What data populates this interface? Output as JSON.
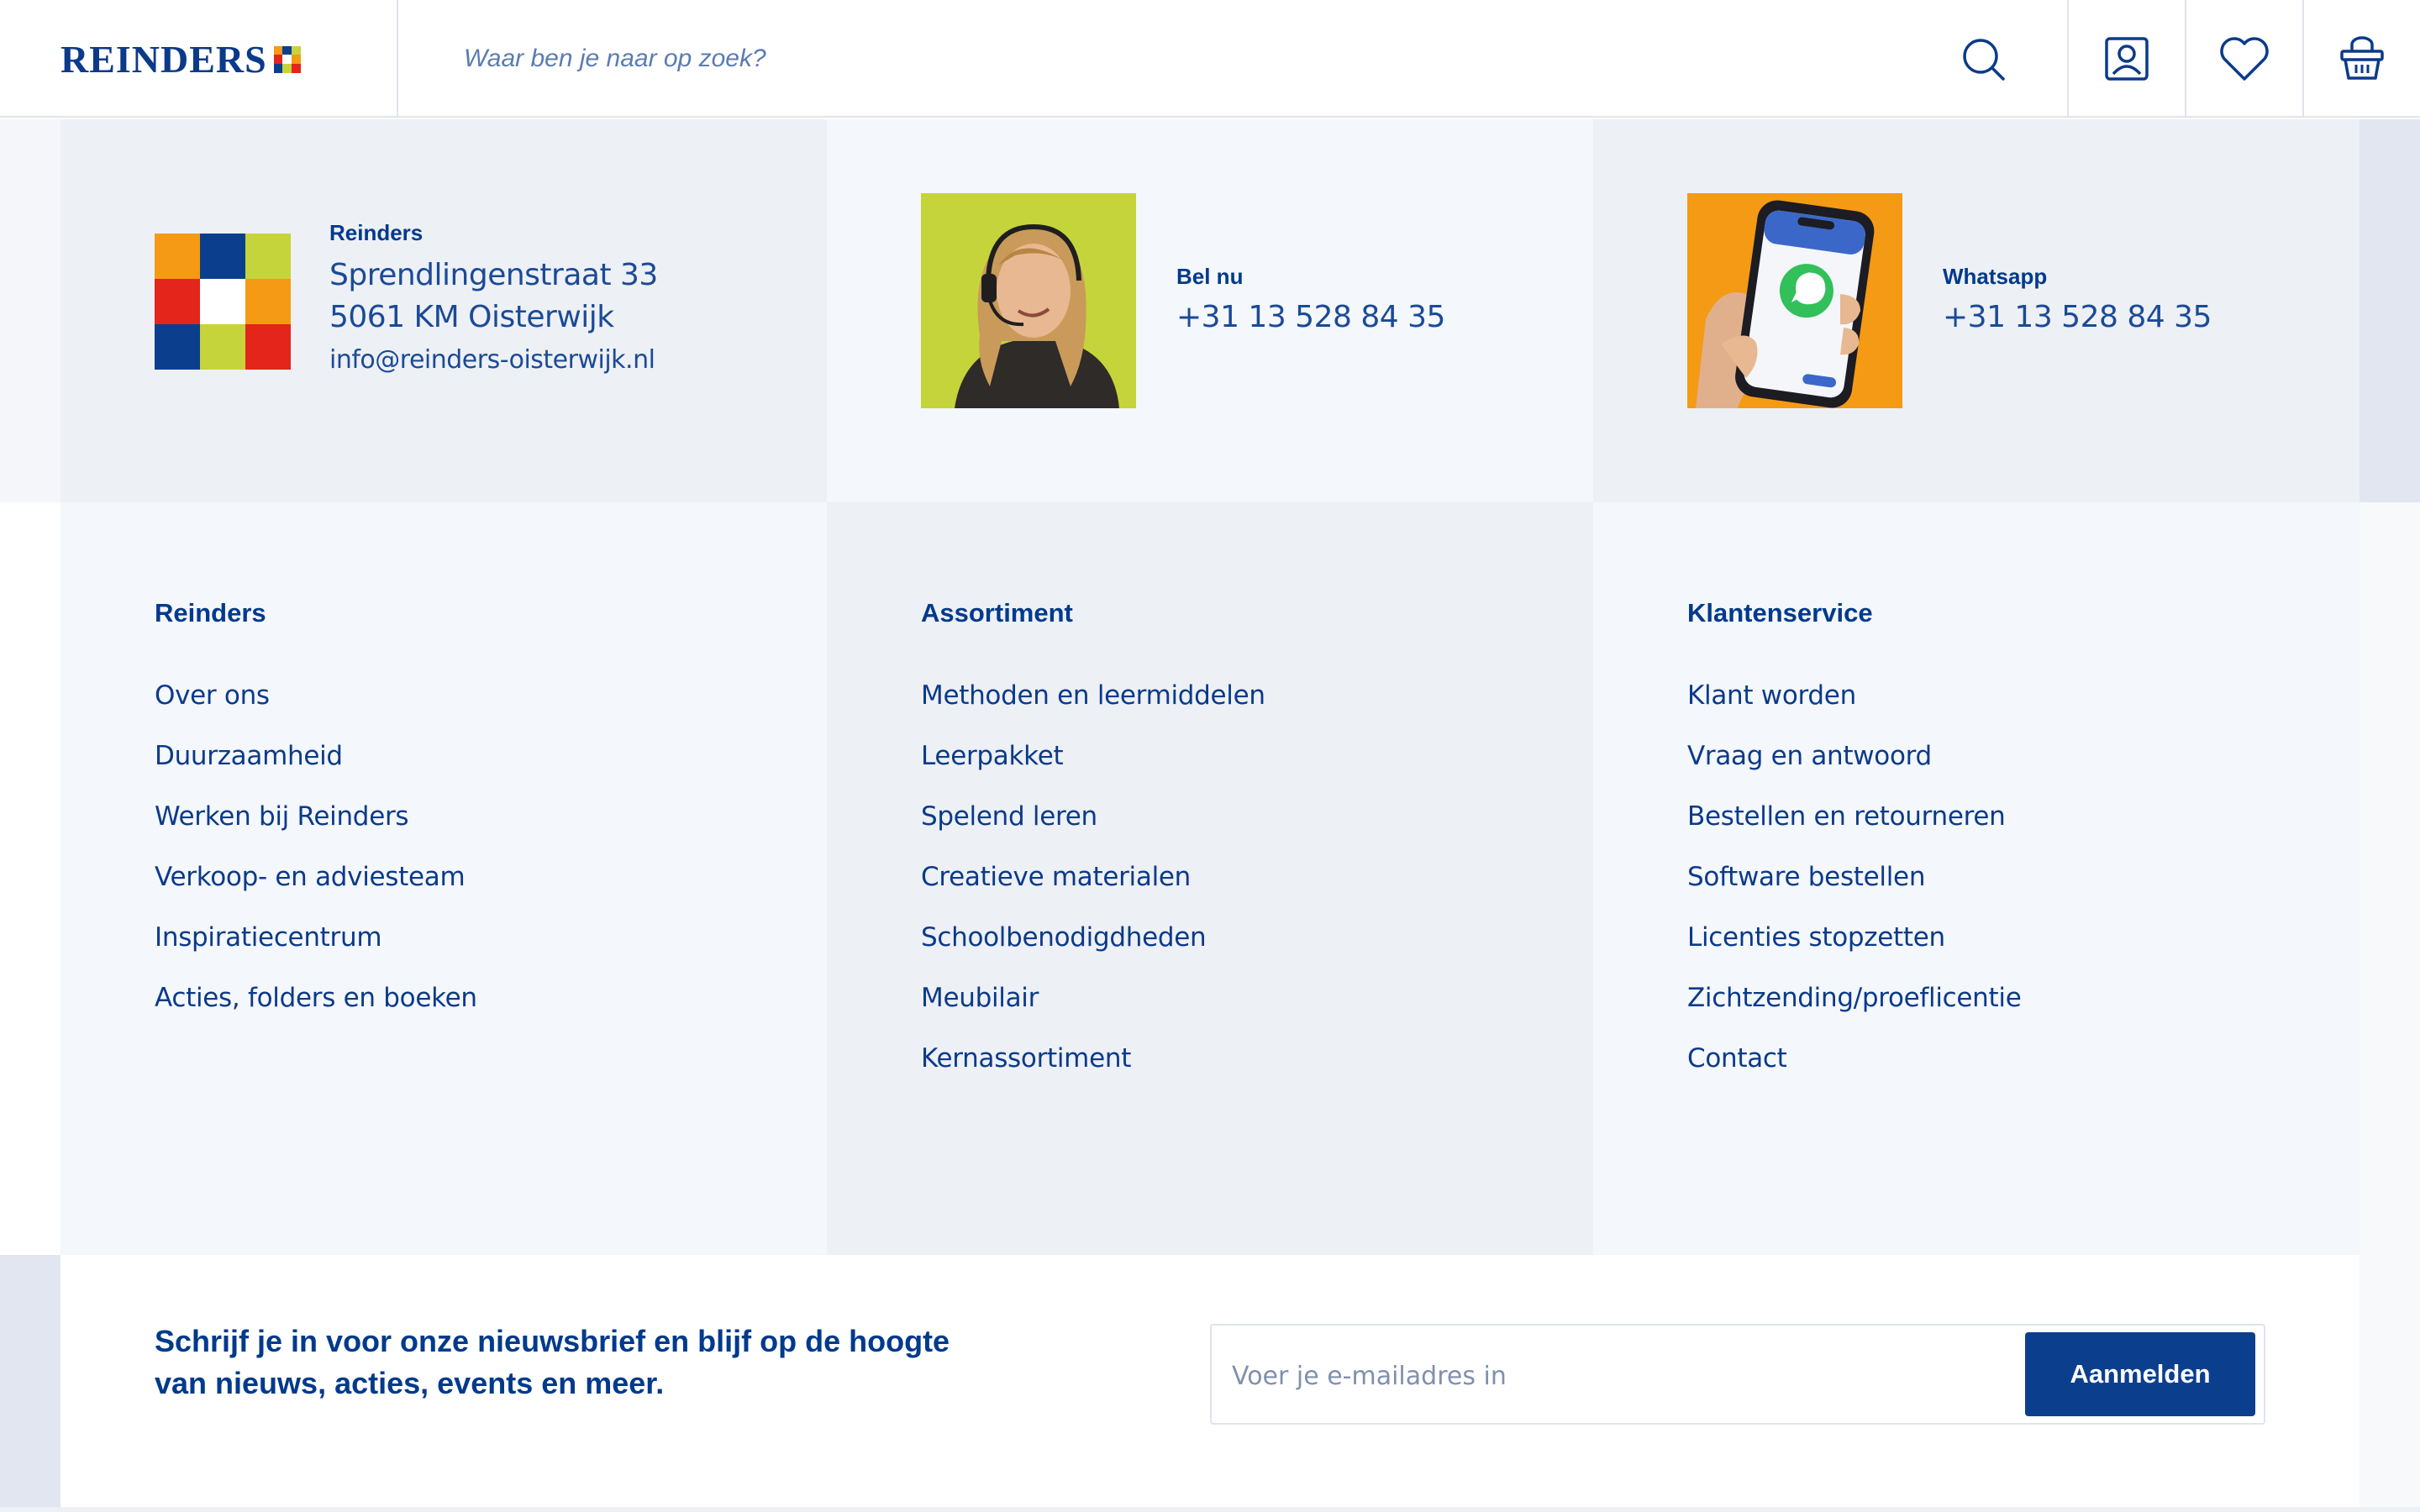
{
  "header": {
    "logo_text": "REINDERS",
    "search_placeholder": "Waar ben je naar op zoek?",
    "icons": [
      "search-icon",
      "account-icon",
      "heart-icon",
      "basket-icon"
    ]
  },
  "brand_colors": {
    "primary": "#003a8c",
    "orange": "#f59a14",
    "blue": "#0b3f8e",
    "lime": "#c5d43a",
    "red": "#e3251b",
    "white": "#ffffff"
  },
  "contact": {
    "company": {
      "name": "Reinders",
      "street": "Sprendlingenstraat 33",
      "city": "5061 KM Oisterwijk",
      "email": "info@reinders-oisterwijk.nl"
    },
    "call": {
      "label": "Bel nu",
      "value": "+31 13 528 84 35"
    },
    "whatsapp": {
      "label": "Whatsapp",
      "value": "+31 13 528 84 35"
    }
  },
  "footer_columns": [
    {
      "title": "Reinders",
      "links": [
        "Over ons",
        "Duurzaamheid",
        "Werken bij Reinders",
        "Verkoop- en adviesteam",
        "Inspiratiecentrum",
        "Acties, folders en boeken"
      ]
    },
    {
      "title": "Assortiment",
      "links": [
        "Methoden en leermiddelen",
        "Leerpakket",
        "Spelend leren",
        "Creatieve materialen",
        "Schoolbenodigdheden",
        "Meubilair",
        "Kernassortiment"
      ]
    },
    {
      "title": "Klantenservice",
      "links": [
        "Klant worden",
        "Vraag en antwoord",
        "Bestellen en retourneren",
        "Software bestellen",
        "Licenties stopzetten",
        "Zichtzending/proeflicentie",
        "Contact"
      ]
    }
  ],
  "newsletter": {
    "line1": "Schrijf je in voor onze nieuwsbrief en blijf op de hoogte",
    "line2": "van nieuws, acties, events en meer.",
    "email_placeholder": "Voer je e-mailadres in",
    "submit_label": "Aanmelden"
  }
}
